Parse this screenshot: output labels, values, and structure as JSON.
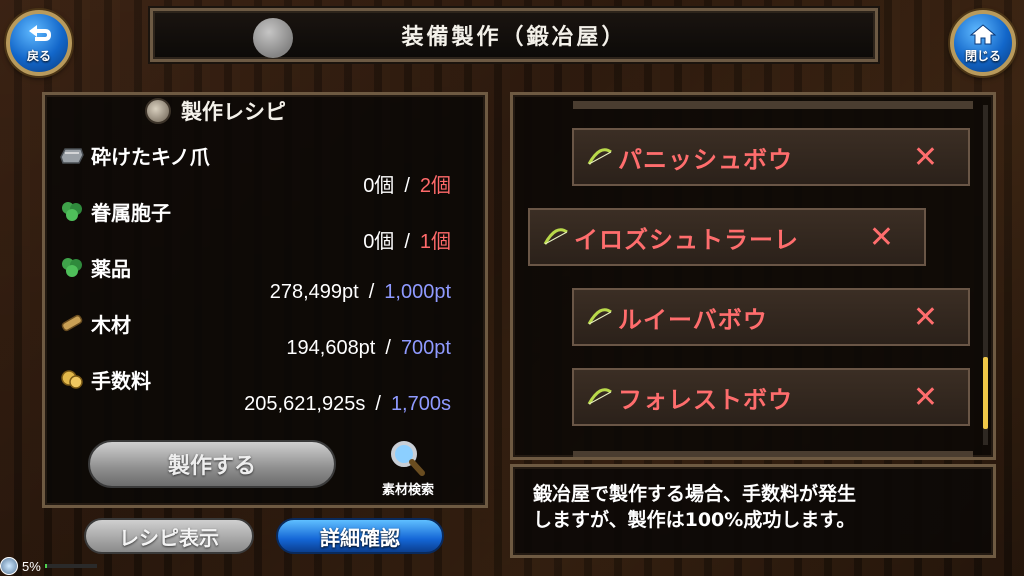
{
  "header": {
    "title": "装備製作（鍛冶屋）",
    "back_label": "戻る",
    "close_label": "閉じる"
  },
  "recipe": {
    "title": "製作レシピ",
    "materials": [
      {
        "name": "砕けたキノ爪",
        "icon": "claw-icon",
        "owned": "0個",
        "required": "2個",
        "required_color": "#ff6a6a"
      },
      {
        "name": "眷属胞子",
        "icon": "spore-icon",
        "owned": "0個",
        "required": "1個",
        "required_color": "#ff6a6a"
      },
      {
        "name": "薬品",
        "icon": "herb-icon",
        "owned": "278,499pt",
        "required": "1,000pt",
        "required_color": "#8f9aff"
      },
      {
        "name": "木材",
        "icon": "wood-icon",
        "owned": "194,608pt",
        "required": "700pt",
        "required_color": "#8f9aff"
      },
      {
        "name": "手数料",
        "icon": "coin-icon",
        "owned": "205,621,925s",
        "required": "1,700s",
        "required_color": "#8f9aff"
      }
    ],
    "separator": "/",
    "craft_label": "製作する",
    "search_label": "素材検索"
  },
  "bottom_buttons": {
    "recipe_view": "レシピ表示",
    "detail_check": "詳細確認"
  },
  "status": {
    "text": "5%",
    "progress": 0.05
  },
  "equipment_list": [
    {
      "name": "パニッシュボウ",
      "mark": "✕"
    },
    {
      "name": "イロズシュトラーレ",
      "mark": "✕"
    },
    {
      "name": "ルイーバボウ",
      "mark": "✕"
    },
    {
      "name": "フォレストボウ",
      "mark": "✕"
    }
  ],
  "description": "鍛冶屋で製作する場合、手数料が発生\nしますが、製作は100%成功します。",
  "colors": {
    "accent_blue": "#1266c9",
    "frame_gold": "#b89a5c",
    "unavailable_red": "#ff6d6d",
    "scroll_thumb": "#f0c848"
  }
}
